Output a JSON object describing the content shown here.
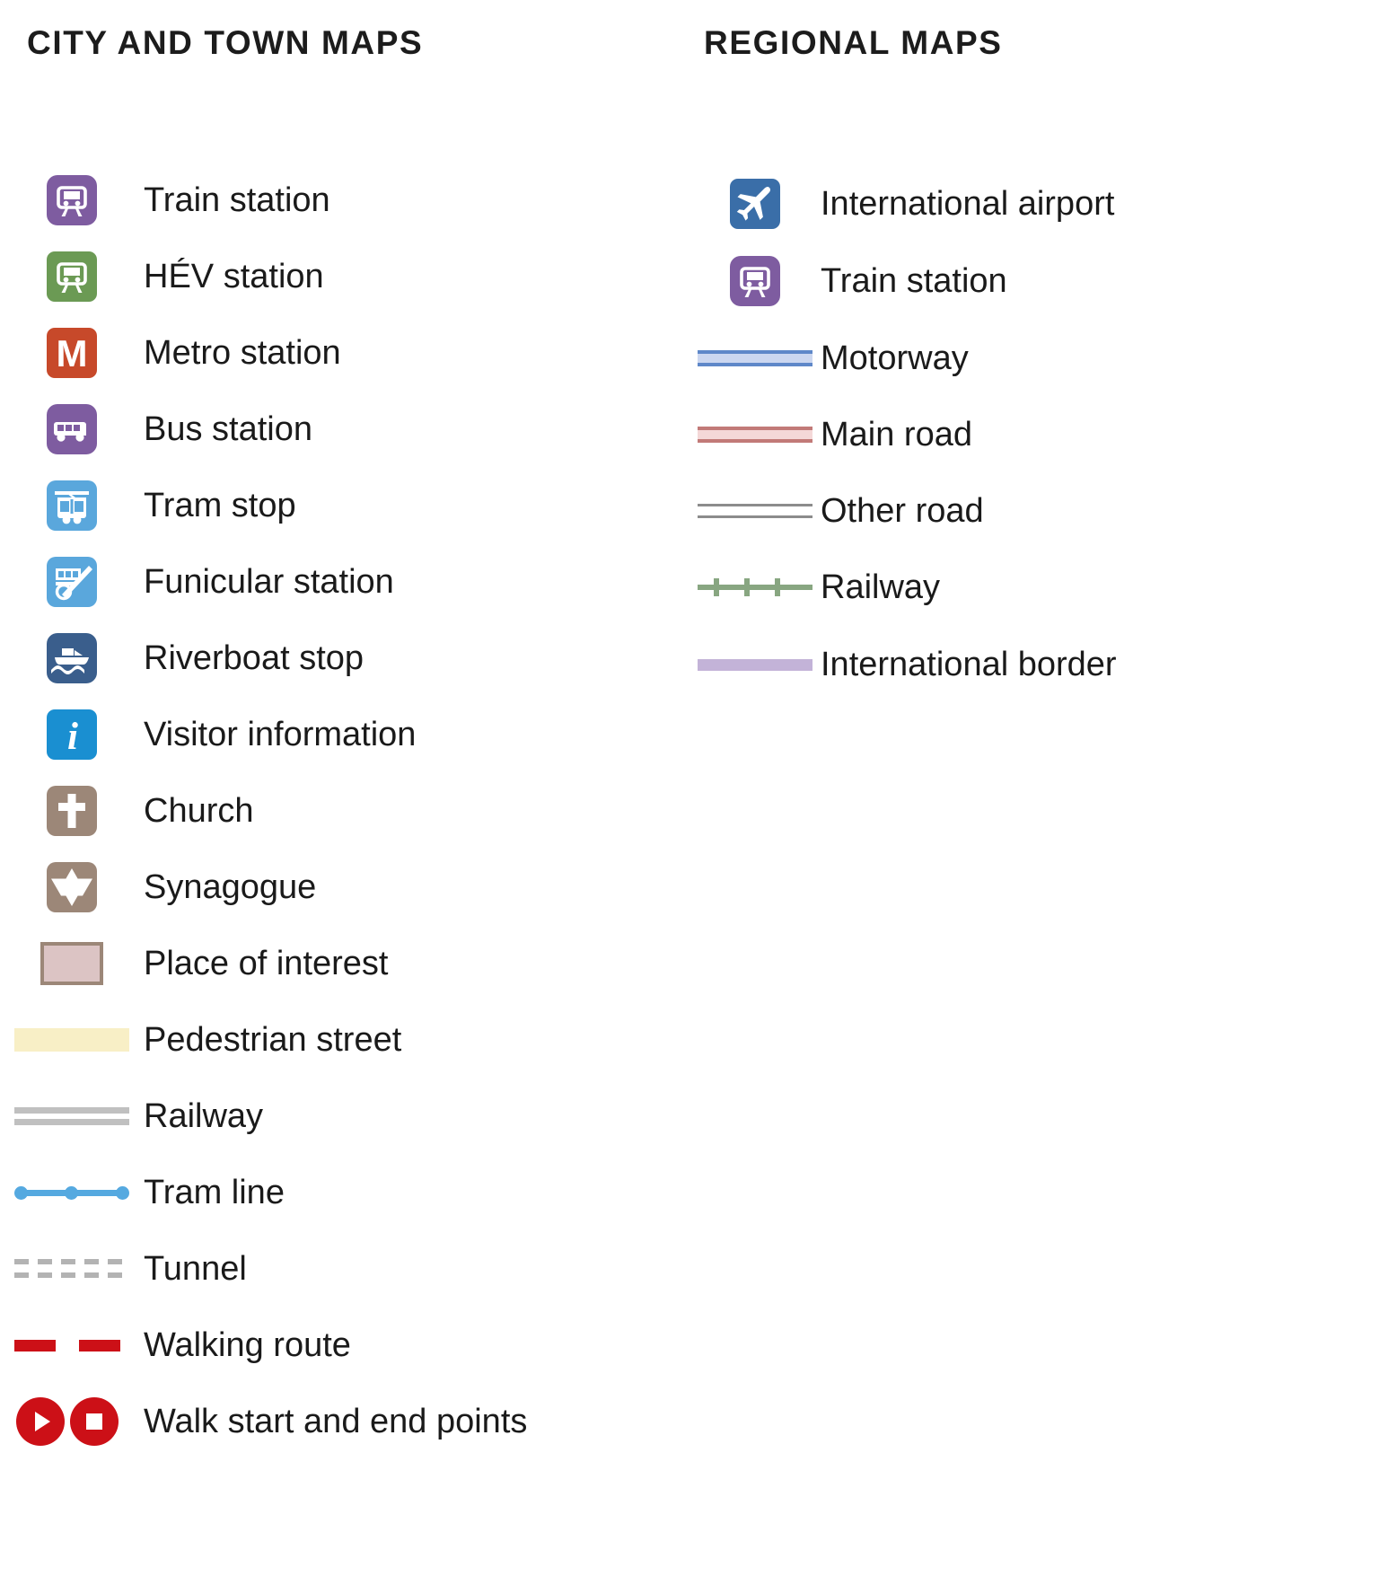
{
  "columns": [
    {
      "id": "city-and-town-maps",
      "title": "CITY AND TOWN MAPS",
      "items": [
        {
          "label": "Train station",
          "symbol": "train-station-icon",
          "color": "#7e5ca0"
        },
        {
          "label": "HÉV station",
          "symbol": "hev-station-icon",
          "color": "#6b9a54"
        },
        {
          "label": "Metro station",
          "symbol": "metro-station-icon",
          "color": "#c7492a"
        },
        {
          "label": "Bus station",
          "symbol": "bus-station-icon",
          "color": "#7e5ca0"
        },
        {
          "label": "Tram stop",
          "symbol": "tram-stop-icon",
          "color": "#5aa7dc"
        },
        {
          "label": "Funicular station",
          "symbol": "funicular-station-icon",
          "color": "#5aa7dc"
        },
        {
          "label": "Riverboat stop",
          "symbol": "riverboat-stop-icon",
          "color": "#3a5e8c"
        },
        {
          "label": "Visitor information",
          "symbol": "visitor-information-icon",
          "color": "#1a8fd1"
        },
        {
          "label": "Church",
          "symbol": "church-icon",
          "color": "#9c8778"
        },
        {
          "label": "Synagogue",
          "symbol": "synagogue-icon",
          "color": "#9c8778"
        },
        {
          "label": "Place of interest",
          "symbol": "place-of-interest-swatch",
          "color": "#dcc4c4"
        },
        {
          "label": "Pedestrian street",
          "symbol": "pedestrian-street-band",
          "color": "#f8efc6"
        },
        {
          "label": "Railway",
          "symbol": "railway-line",
          "color": "#c0c0c0"
        },
        {
          "label": "Tram line",
          "symbol": "tram-line",
          "color": "#55a9e0"
        },
        {
          "label": "Tunnel",
          "symbol": "tunnel-line",
          "color": "#b3b3b3"
        },
        {
          "label": "Walking route",
          "symbol": "walking-route-line",
          "color": "#cc1017"
        },
        {
          "label": "Walk start and end points",
          "symbol": "walk-start-end-markers",
          "color": "#cc1017"
        }
      ]
    },
    {
      "id": "regional-maps",
      "title": "REGIONAL MAPS",
      "items": [
        {
          "label": "International airport",
          "symbol": "international-airport-icon",
          "color": "#3a6ea8"
        },
        {
          "label": "Train station",
          "symbol": "train-station-icon",
          "color": "#7e5ca0"
        },
        {
          "label": "Motorway",
          "symbol": "motorway-line",
          "color": "#5f88c9"
        },
        {
          "label": "Main road",
          "symbol": "main-road-line",
          "color": "#c27a78"
        },
        {
          "label": "Other road",
          "symbol": "other-road-line",
          "color": "#8c8c8c"
        },
        {
          "label": "Railway",
          "symbol": "regional-railway-line",
          "color": "#88a681"
        },
        {
          "label": "International border",
          "symbol": "international-border-line",
          "color": "#c3b3d8"
        }
      ]
    }
  ]
}
